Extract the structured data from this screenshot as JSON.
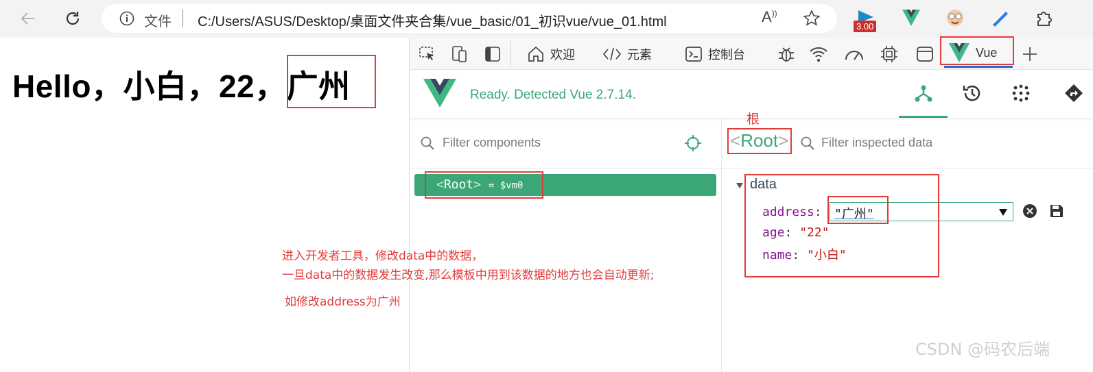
{
  "browser": {
    "address_label": "文件",
    "url": "C:/Users/ASUS/Desktop/桌面文件夹合集/vue_basic/01_初识vue/vue_01.html",
    "ext_badge": "3.00"
  },
  "page": {
    "heading": "Hello，小白，22，广州"
  },
  "devtools": {
    "tabs": {
      "welcome": "欢迎",
      "elements": "元素",
      "console": "控制台",
      "vue": "Vue"
    },
    "vue_status": "Ready. Detected Vue 2.7.14.",
    "filter_components_placeholder": "Filter components",
    "filter_inspected_placeholder": "Filter inspected data",
    "selected_component": "Root",
    "root_node": {
      "name": "Root",
      "vm": "= $vm0"
    },
    "data_section_label": "data",
    "data": {
      "address_key": "address",
      "address_value": "\"广州\"",
      "age_key": "age",
      "age_value": "\"22\"",
      "name_key": "name",
      "name_value": "\"小白\""
    }
  },
  "annotations": {
    "root_label": "根",
    "line1": "进入开发者工具，修改data中的数据，",
    "line2": "一旦data中的数据发生改变,那么模板中用到该数据的地方也会自动更新;",
    "line3": "如修改address为广州"
  },
  "watermark": "CSDN @码农后端",
  "colors": {
    "vue_green": "#3ba776",
    "annotation_red": "#e23b3b",
    "vue_dark": "#34495e"
  }
}
